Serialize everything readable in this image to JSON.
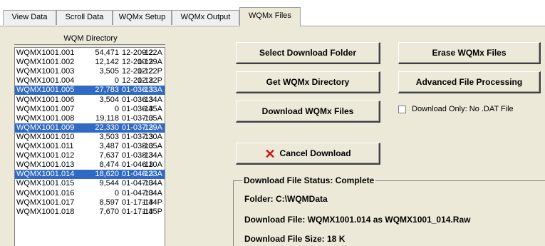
{
  "tabs": [
    {
      "label": "View Data"
    },
    {
      "label": "Scroll Data"
    },
    {
      "label": "WQMx Setup"
    },
    {
      "label": "WQMx Output"
    },
    {
      "label": "WQMx Files"
    }
  ],
  "directory": {
    "caption": "WQM Directory",
    "rows": [
      {
        "name": "WQMX1001.001",
        "size": "54,471",
        "date": "12-20-12",
        "time": "9:22A",
        "selected": false
      },
      {
        "name": "WQMX1001.002",
        "size": "12,142",
        "date": "12-20-12",
        "time": "10:39A",
        "selected": false
      },
      {
        "name": "WQMX1001.003",
        "size": "3,505",
        "date": "12-20-12",
        "time": "12:22P",
        "selected": false
      },
      {
        "name": "WQMX1001.004",
        "size": "0",
        "date": "12-20-12",
        "time": "12:32P",
        "selected": false
      },
      {
        "name": "WQMX1001.005",
        "size": "27,783",
        "date": "01-03-13",
        "time": "6:33A",
        "selected": true
      },
      {
        "name": "WQMX1001.006",
        "size": "3,504",
        "date": "01-03-13",
        "time": "6:34A",
        "selected": false
      },
      {
        "name": "WQMX1001.007",
        "size": "0",
        "date": "01-03-13",
        "time": "6:45A",
        "selected": false
      },
      {
        "name": "WQMX1001.008",
        "size": "19,118",
        "date": "01-03-13",
        "time": "7:05A",
        "selected": false
      },
      {
        "name": "WQMX1001.009",
        "size": "22,330",
        "date": "01-03-13",
        "time": "7:29A",
        "selected": true
      },
      {
        "name": "WQMX1001.010",
        "size": "3,503",
        "date": "01-03-13",
        "time": "7:30A",
        "selected": false
      },
      {
        "name": "WQMX1001.011",
        "size": "3,487",
        "date": "01-03-13",
        "time": "8:05A",
        "selected": false
      },
      {
        "name": "WQMX1001.012",
        "size": "7,637",
        "date": "01-03-13",
        "time": "8:34A",
        "selected": false
      },
      {
        "name": "WQMX1001.013",
        "size": "8,474",
        "date": "01-04-13",
        "time": "6:10A",
        "selected": false
      },
      {
        "name": "WQMX1001.014",
        "size": "18,620",
        "date": "01-04-13",
        "time": "6:23A",
        "selected": true
      },
      {
        "name": "WQMX1001.015",
        "size": "9,544",
        "date": "01-04-13",
        "time": "7:04A",
        "selected": false
      },
      {
        "name": "WQMX1001.016",
        "size": "0",
        "date": "01-04-13",
        "time": "7:04A",
        "selected": false
      },
      {
        "name": "WQMX1001.017",
        "size": "8,597",
        "date": "01-17-13",
        "time": "1:44P",
        "selected": false
      },
      {
        "name": "WQMX1001.018",
        "size": "7,670",
        "date": "01-17-13",
        "time": "1:45P",
        "selected": false
      }
    ]
  },
  "buttons": {
    "select_download_folder": "Select Download Folder",
    "get_directory": "Get WQMx Directory",
    "download_files": "Download WQMx Files",
    "cancel_download": "Cancel  Download",
    "erase_files": "Erase WQMx Files",
    "advanced_processing": "Advanced File Processing"
  },
  "checkbox": {
    "label": "Download Only:  No .DAT File",
    "checked": false
  },
  "status": {
    "title": "Download File Status:  Complete",
    "folder": "Folder:  C:\\WQMData",
    "file": "Download File: WQMX1001.014 as WQMX1001_014.Raw",
    "size": "Download File Size: 18 K"
  },
  "colors": {
    "selection": "#316ac5",
    "panel": "#ece9d8",
    "cancel_icon": "#cc1010"
  },
  "icons": {
    "cancel": "x-icon"
  }
}
